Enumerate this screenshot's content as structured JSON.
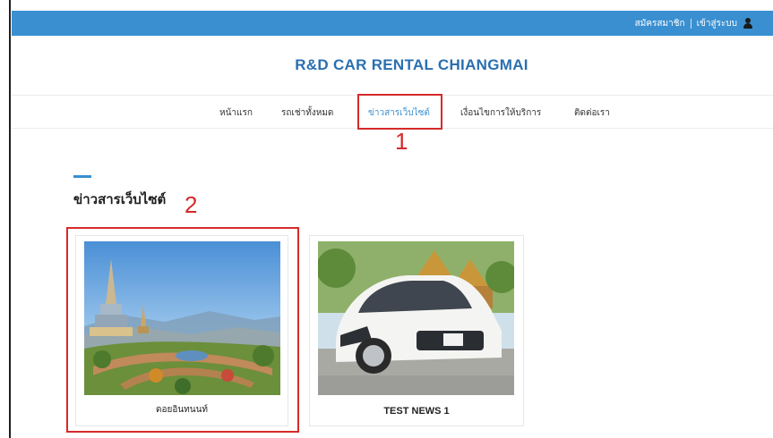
{
  "topbar": {
    "register_label": "สมัครสมาชิก",
    "login_label": "เข้าสู่ระบบ",
    "bg_color": "#3a8fd0",
    "user_icon": "user-icon"
  },
  "brand": {
    "title": "R&D CAR RENTAL CHIANGMAI",
    "color": "#2a6fb0"
  },
  "nav": {
    "items": [
      {
        "label": "หน้าแรก"
      },
      {
        "label": "รถเช่าทั้งหมด"
      },
      {
        "label": "ข่าวสารเว็บไซต์",
        "active": true
      },
      {
        "label": "เงื่อนไขการให้บริการ"
      },
      {
        "label": "ติดต่อเรา"
      }
    ]
  },
  "annotations": {
    "marker_1": "1",
    "marker_2": "2",
    "color": "#d62a2a"
  },
  "section": {
    "title": "ข่าวสารเว็บไซต์"
  },
  "news": [
    {
      "caption": "ดอยอินทนนท์",
      "image": "doi-inthanon-pagoda-photo"
    },
    {
      "caption": "TEST NEWS 1",
      "image": "white-toyota-camry-photo"
    }
  ]
}
